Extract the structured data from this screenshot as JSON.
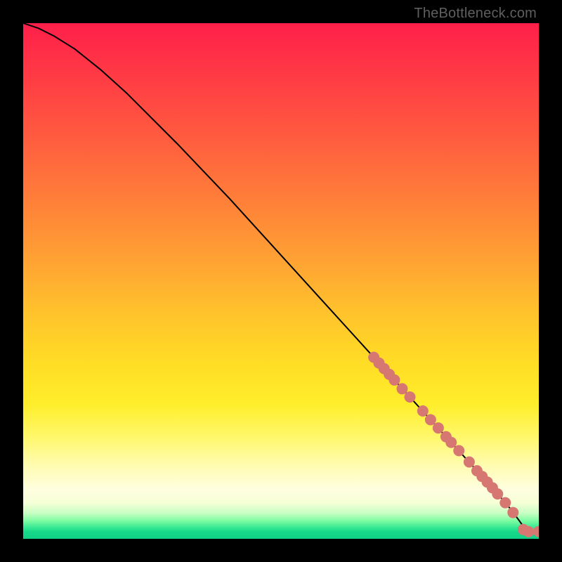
{
  "attribution": "TheBottleneck.com",
  "colors": {
    "dot": "#d77772",
    "curve": "#000000",
    "frame": "#000000"
  },
  "chart_data": {
    "type": "line",
    "title": "",
    "xlabel": "",
    "ylabel": "",
    "xlim": [
      0,
      100
    ],
    "ylim": [
      0,
      100
    ],
    "grid": false,
    "legend": false,
    "series": [
      {
        "name": "bottleneck-curve",
        "x": [
          0,
          3,
          6,
          10,
          15,
          20,
          30,
          40,
          50,
          60,
          68,
          72,
          75,
          78,
          80,
          82,
          84,
          86,
          88,
          90,
          91.5,
          93,
          94.5,
          96,
          97,
          98,
          100
        ],
        "y": [
          100,
          99,
          97.5,
          95,
          91,
          86.5,
          76.5,
          66,
          55,
          44,
          35.2,
          30.8,
          27.5,
          24.2,
          22,
          19.8,
          17.6,
          15.4,
          13.2,
          11,
          9.3,
          7.6,
          5.8,
          3.8,
          2.4,
          1.4,
          1.4
        ]
      }
    ],
    "points": [
      {
        "x": 68.0,
        "y": 35.2
      },
      {
        "x": 69.0,
        "y": 34.1
      },
      {
        "x": 70.0,
        "y": 33.0
      },
      {
        "x": 71.0,
        "y": 31.9
      },
      {
        "x": 72.0,
        "y": 30.8
      },
      {
        "x": 73.5,
        "y": 29.1
      },
      {
        "x": 75.0,
        "y": 27.5
      },
      {
        "x": 77.5,
        "y": 24.8
      },
      {
        "x": 79.0,
        "y": 23.1
      },
      {
        "x": 80.5,
        "y": 21.5
      },
      {
        "x": 82.0,
        "y": 19.8
      },
      {
        "x": 83.0,
        "y": 18.7
      },
      {
        "x": 84.5,
        "y": 17.1
      },
      {
        "x": 86.5,
        "y": 14.9
      },
      {
        "x": 88.0,
        "y": 13.2
      },
      {
        "x": 89.0,
        "y": 12.1
      },
      {
        "x": 90.0,
        "y": 11.0
      },
      {
        "x": 91.0,
        "y": 9.9
      },
      {
        "x": 92.0,
        "y": 8.7
      },
      {
        "x": 93.5,
        "y": 7.0
      },
      {
        "x": 95.0,
        "y": 5.1
      },
      {
        "x": 97.0,
        "y": 1.8
      },
      {
        "x": 98.0,
        "y": 1.4
      },
      {
        "x": 100.0,
        "y": 1.4
      }
    ],
    "point_radius": 8
  }
}
